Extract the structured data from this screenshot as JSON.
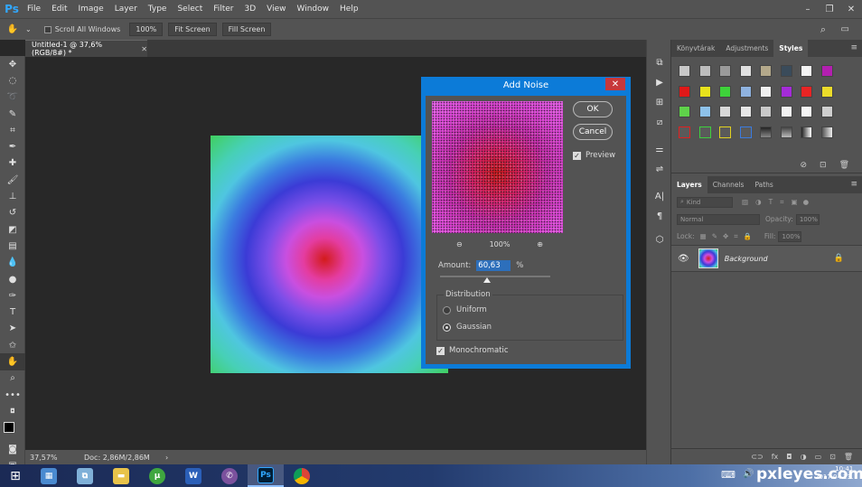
{
  "app": {
    "logo": "Ps",
    "accent": "#31a8ff"
  },
  "menu": [
    "File",
    "Edit",
    "Image",
    "Layer",
    "Type",
    "Select",
    "Filter",
    "3D",
    "View",
    "Window",
    "Help"
  ],
  "options": {
    "scroll_all": "Scroll All Windows",
    "zoom": "100%",
    "fit": "Fit Screen",
    "fill": "Fill Screen"
  },
  "document": {
    "tab_title": "Untitled-1 @ 37,6% (RGB/8#) *",
    "zoom": "37,57%",
    "doc_size": "Doc: 2,86M/2,86M"
  },
  "dialog": {
    "title": "Add Noise",
    "ok": "OK",
    "cancel": "Cancel",
    "preview_label": "Preview",
    "zoom": "100%",
    "amount_label": "Amount:",
    "amount_value": "60,63",
    "amount_unit": "%",
    "distribution_label": "Distribution",
    "uniform": "Uniform",
    "gaussian": "Gaussian",
    "monochromatic": "Monochromatic",
    "color": "#0c7bd8"
  },
  "panels": {
    "top_tabs": [
      "Könyvtárak",
      "Adjustments",
      "Styles"
    ],
    "layer_tabs": [
      "Layers",
      "Channels",
      "Paths"
    ],
    "kind": "Kind",
    "blend_mode": "Normal",
    "opacity_label": "Opacity:",
    "opacity": "100%",
    "lock_label": "Lock:",
    "fill_label": "Fill:",
    "fill": "100%",
    "layer_name": "Background"
  },
  "taskbar": {
    "watermark": "pxleyes.com",
    "time": "10:41",
    "date": "2017.04.23."
  }
}
